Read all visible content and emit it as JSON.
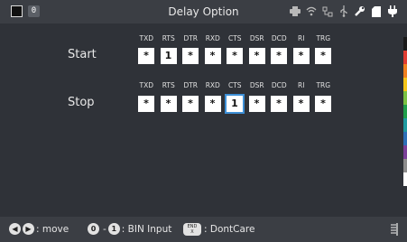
{
  "titlebar": {
    "title": "Delay Option",
    "channel": "0",
    "icons": [
      "printer-icon",
      "wifi-icon",
      "network-icon",
      "usb-icon",
      "wrench-icon",
      "memory-card-icon",
      "power-plug-icon"
    ]
  },
  "columns": [
    "TXD",
    "RTS",
    "DTR",
    "RXD",
    "CTS",
    "DSR",
    "DCD",
    "RI",
    "TRG"
  ],
  "rows": [
    {
      "label": "Start",
      "values": [
        "*",
        "1",
        "*",
        "*",
        "*",
        "*",
        "*",
        "*",
        "*"
      ],
      "selected_index": null
    },
    {
      "label": "Stop",
      "values": [
        "*",
        "*",
        "*",
        "*",
        "1",
        "*",
        "*",
        "*",
        "*"
      ],
      "selected_index": 4
    }
  ],
  "colors": {
    "selection": "#3d8fd6",
    "colorbar": [
      "#1a1a1a",
      "#e03c31",
      "#f07f1e",
      "#f5c518",
      "#7ac142",
      "#1f9e4a",
      "#1e9aa0",
      "#2c6fb7",
      "#7a3f98",
      "#8c8c8c",
      "#ffffff"
    ]
  },
  "bottombar": {
    "move_label": ": move",
    "digit_zero": "0",
    "dash": "-",
    "digit_one": "1",
    "bin_label": ": BIN Input",
    "end_key_top": "END",
    "end_key_bottom": "X",
    "dontcare_label": ": DontCare"
  }
}
